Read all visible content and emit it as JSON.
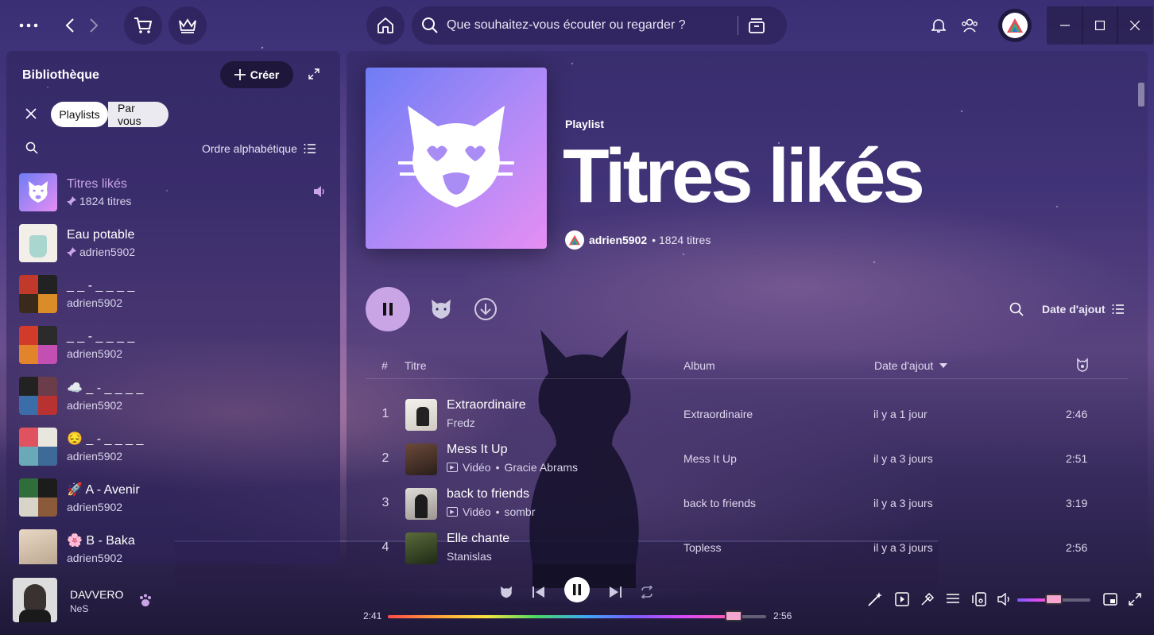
{
  "topbar": {
    "search_placeholder": "Que souhaitez-vous écouter ou regarder ?",
    "icons": [
      "more-icon",
      "back-icon",
      "forward-icon",
      "cart-icon",
      "crown-icon",
      "home-icon",
      "search-icon",
      "browse-icon",
      "bell-icon",
      "friends-icon",
      "avatar",
      "minimize-icon",
      "maximize-icon",
      "close-icon"
    ]
  },
  "library": {
    "title": "Bibliothèque",
    "create_label": "Créer",
    "filters": [
      "Playlists",
      "Par vous"
    ],
    "sort_label": "Ordre alphabétique",
    "items": [
      {
        "name": "Titres likés",
        "sub": "1824 titres",
        "pinned": true,
        "active": true
      },
      {
        "name": "Eau potable",
        "sub": "adrien5902",
        "pinned": true
      },
      {
        "name": "_ _ - _ _ _ _",
        "sub": "adrien5902"
      },
      {
        "name": "_ _ - _ _ _ _",
        "sub": "adrien5902"
      },
      {
        "name": "☁️ _ - _ _ _ _",
        "sub": "adrien5902"
      },
      {
        "name": "😔 _ - _ _ _ _",
        "sub": "adrien5902"
      },
      {
        "name": "🚀 A - Avenir",
        "sub": "adrien5902"
      },
      {
        "name": "🌸 B - Baka",
        "sub": "adrien5902"
      }
    ]
  },
  "playlist": {
    "type": "Playlist",
    "title": "Titres likés",
    "owner": "adrien5902",
    "count": "• 1824 titres",
    "sort_label": "Date d'ajout",
    "columns": {
      "num": "#",
      "title": "Titre",
      "album": "Album",
      "date": "Date d'ajout"
    },
    "tracks": [
      {
        "num": "1",
        "title": "Extraordinaire",
        "artist": "Fredz",
        "video": false,
        "album": "Extraordinaire",
        "date": "il y a 1 jour",
        "duration": "2:46"
      },
      {
        "num": "2",
        "title": "Mess It Up",
        "artist": "Gracie Abrams",
        "video": true,
        "video_label": "Vidéo",
        "album": "Mess It Up",
        "date": "il y a 3 jours",
        "duration": "2:51"
      },
      {
        "num": "3",
        "title": "back to friends",
        "artist": "sombr",
        "video": true,
        "video_label": "Vidéo",
        "album": "back to friends",
        "date": "il y a 3 jours",
        "duration": "3:19"
      },
      {
        "num": "4",
        "title": "Elle chante",
        "artist": "Stanislas",
        "video": false,
        "album": "Topless",
        "date": "il y a 3 jours",
        "duration": "2:56"
      }
    ]
  },
  "player": {
    "track_title": "DAVVERO",
    "track_artist": "NeS",
    "elapsed": "2:41",
    "total": "2:56",
    "progress": 0.914,
    "volume": 0.5
  },
  "colors": {
    "accent": "#c9a5e6",
    "cover_start": "#6e7cf5",
    "cover_end": "#e58ef3"
  }
}
